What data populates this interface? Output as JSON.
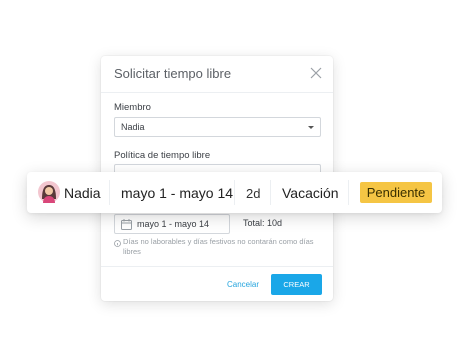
{
  "modal": {
    "title": "Solicitar tiempo libre",
    "member_label": "Miembro",
    "member_value": "Nadia",
    "policy_label": "Política de tiempo libre",
    "date_value": "mayo 1 - mayo 14",
    "total_text": "Total: 10d",
    "note": "Días no laborables y días festivos no contarán como días libres",
    "cancel_label": "Cancelar",
    "create_label": "CREAR"
  },
  "request_card": {
    "name": "Nadia",
    "date_range": "mayo 1 - mayo 14",
    "days": "2d",
    "type": "Vacación",
    "status": "Pendiente"
  },
  "colors": {
    "accent": "#1aa7e8",
    "status_pending": "#f5c544"
  },
  "icons": [
    "close-icon",
    "chevron-down-icon",
    "calendar-icon",
    "info-icon",
    "avatar"
  ]
}
